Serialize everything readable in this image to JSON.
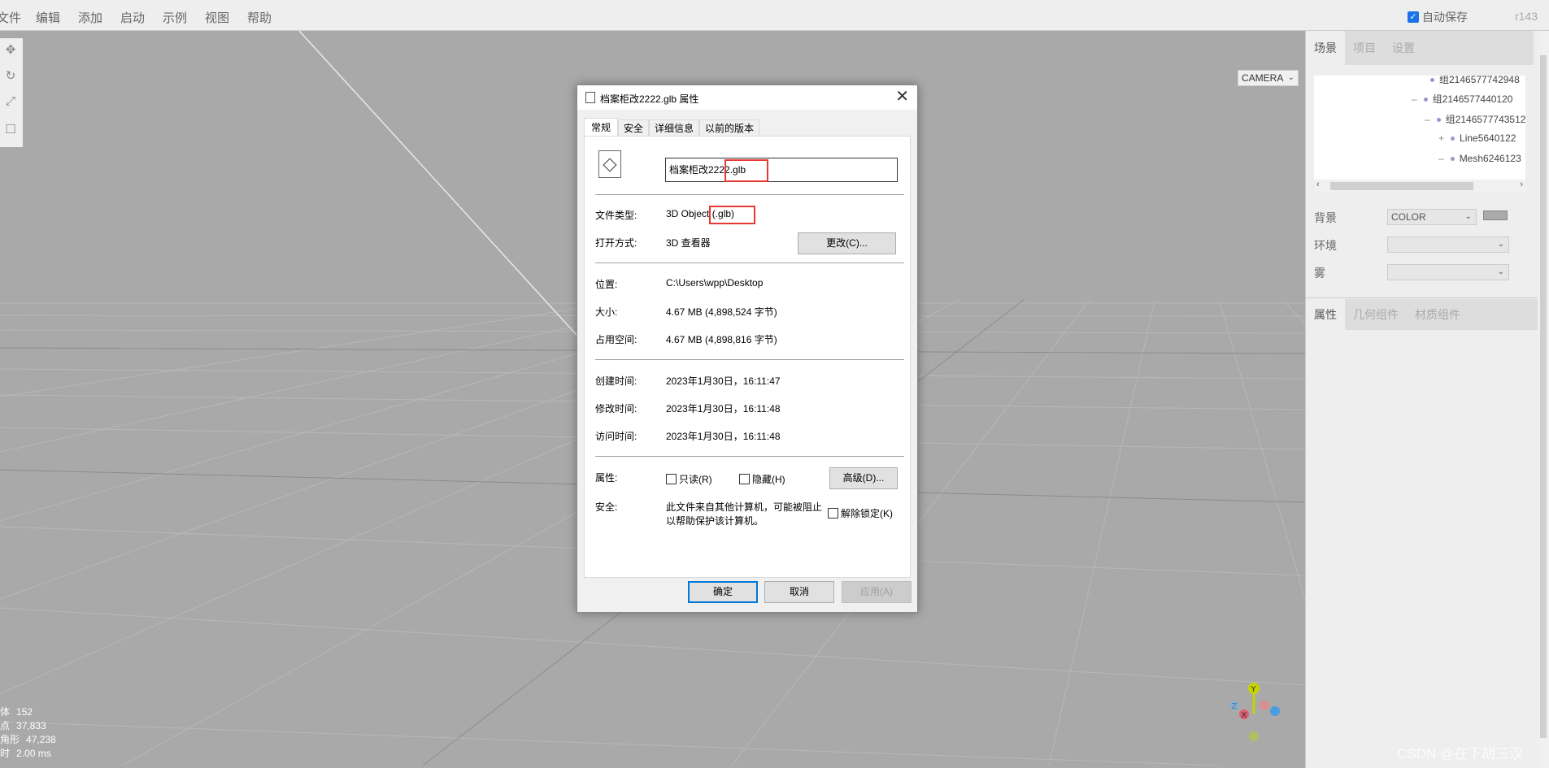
{
  "menubar": {
    "items": [
      "文件",
      "编辑",
      "添加",
      "启动",
      "示例",
      "视图",
      "帮助"
    ],
    "autosave_label": "自动保存",
    "autosave_checked": true,
    "version": "r143"
  },
  "viewport": {
    "camera": "CAMERA",
    "tools": [
      "move-icon",
      "rotate-icon",
      "scale-icon",
      "toggle-icon"
    ],
    "stats": [
      {
        "label": "物体",
        "value": "152"
      },
      {
        "label": "顶点",
        "value": "37,833"
      },
      {
        "label": "三角形",
        "value": "47,238"
      },
      {
        "label": "帧时",
        "value": "2.00 ms"
      }
    ],
    "gizmo": {
      "y": "Y",
      "z": "Z",
      "x": "X"
    }
  },
  "sidebar": {
    "tabs": [
      "场景",
      "项目",
      "设置"
    ],
    "tree": [
      {
        "toggle": "",
        "label": "组2146577742948"
      },
      {
        "toggle": "–",
        "label": "组2146577440120"
      },
      {
        "toggle": "–",
        "label": "组2146577743512"
      },
      {
        "toggle": "+",
        "label": "Line5640122"
      },
      {
        "toggle": "–",
        "label": "Mesh6246123"
      }
    ],
    "background_label": "背景",
    "background_value": "COLOR",
    "background_color": "#aaaaaa",
    "environment_label": "环境",
    "fog_label": "雾",
    "bottom_tabs": [
      "属性",
      "几何组件",
      "材质组件"
    ]
  },
  "dialog": {
    "title": "档案柜改2222.glb 属性",
    "tabs": [
      "常规",
      "安全",
      "详细信息",
      "以前的版本"
    ],
    "filename": "档案柜改2222.glb",
    "file_type_label": "文件类型:",
    "file_type_value": "3D Object (.glb)",
    "open_with_label": "打开方式:",
    "open_with_value": "3D 查看器",
    "change_button": "更改(C)...",
    "location_label": "位置:",
    "location_value": "C:\\Users\\wpp\\Desktop",
    "size_label": "大小:",
    "size_value": "4.67 MB (4,898,524 字节)",
    "disk_label": "占用空间:",
    "disk_value": "4.67 MB (4,898,816 字节)",
    "created_label": "创建时间:",
    "created_value": "2023年1月30日，16:11:47",
    "modified_label": "修改时间:",
    "modified_value": "2023年1月30日，16:11:48",
    "accessed_label": "访问时间:",
    "accessed_value": "2023年1月30日，16:11:48",
    "attributes_label": "属性:",
    "readonly_label": "只读(R)",
    "hidden_label": "隐藏(H)",
    "advanced_button": "高级(D)...",
    "security_label": "安全:",
    "security_text_1": "此文件来自其他计算机，可能被阻止",
    "security_text_2": "以帮助保护该计算机。",
    "unblock_label": "解除锁定(K)",
    "ok_button": "确定",
    "cancel_button": "取消",
    "apply_button": "应用(A)"
  },
  "watermark": "CSDN @在下胡三汉"
}
